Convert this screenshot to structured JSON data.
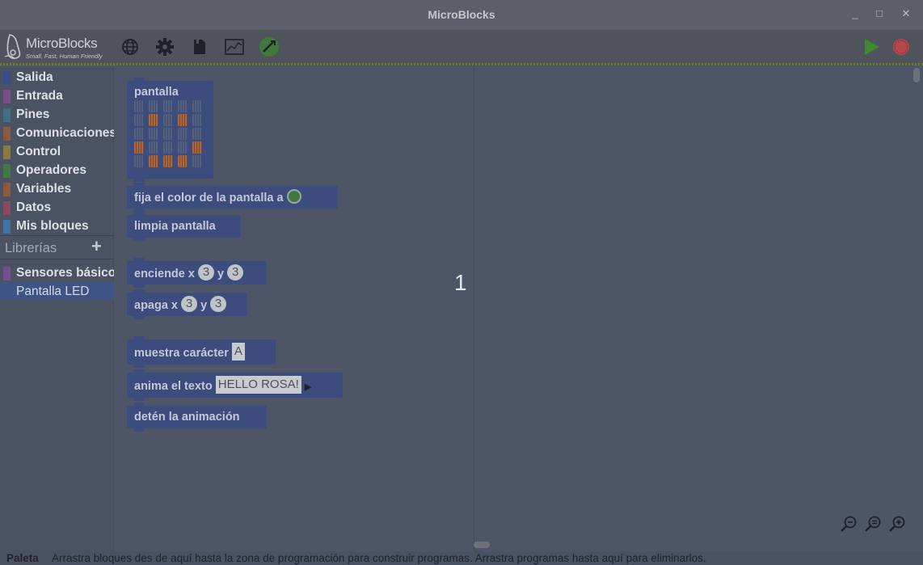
{
  "window": {
    "title": "MicroBlocks",
    "minimize": "_",
    "maximize": "□",
    "close": "✕"
  },
  "logo": {
    "name": "MicroBlocks",
    "tagline": "Small, Fast, Human Friendly"
  },
  "toolbar": {
    "icons": [
      "globe-icon",
      "gear-icon",
      "file-icon",
      "graph-icon",
      "board-connect-icon",
      "start-icon",
      "stop-icon"
    ]
  },
  "categories": [
    {
      "label": "Salida",
      "color": "#3b4c8a"
    },
    {
      "label": "Entrada",
      "color": "#7a4e8e"
    },
    {
      "label": "Pines",
      "color": "#3f6f86"
    },
    {
      "label": "Comunicaciones",
      "color": "#8a5a40"
    },
    {
      "label": "Control",
      "color": "#8a7a40"
    },
    {
      "label": "Operadores",
      "color": "#3f7a45"
    },
    {
      "label": "Variables",
      "color": "#8a5a3a"
    },
    {
      "label": "Datos",
      "color": "#8a4a62"
    },
    {
      "label": "Mis bloques",
      "color": "#3d76a6"
    }
  ],
  "libraries": {
    "header": "Librerías",
    "add": "+",
    "items": [
      {
        "label": "Sensores básicos",
        "color": "#7a4e8e"
      },
      {
        "label": "Pantalla LED",
        "selected": true
      }
    ]
  },
  "palette": {
    "display_block": {
      "label": "pantalla",
      "leds_on": [
        [
          1,
          1
        ],
        [
          1,
          3
        ],
        [
          3,
          0
        ],
        [
          3,
          4
        ],
        [
          4,
          1
        ],
        [
          4,
          2
        ],
        [
          4,
          3
        ]
      ]
    },
    "set_color": {
      "label": "fija el color de la pantalla a"
    },
    "clear": {
      "label": "limpia pantalla"
    },
    "plot": {
      "label": "enciende x",
      "x": "3",
      "y_label": "y",
      "y": "3"
    },
    "unplot": {
      "label": "apaga x",
      "x": "3",
      "y_label": "y",
      "y": "3"
    },
    "show_char": {
      "label": "muestra carácter",
      "value": "A"
    },
    "scroll_text": {
      "label": "anima el texto",
      "value": "HELLO ROSA!"
    },
    "stop_scroll": {
      "label": "detén la animación"
    }
  },
  "overlay_number": "1",
  "status": {
    "key": "Paleta",
    "text": "Arrastra bloques des de aquí hasta la zona de programación para construir programas. Arrastra programas hasta aquí para eliminarlos."
  }
}
